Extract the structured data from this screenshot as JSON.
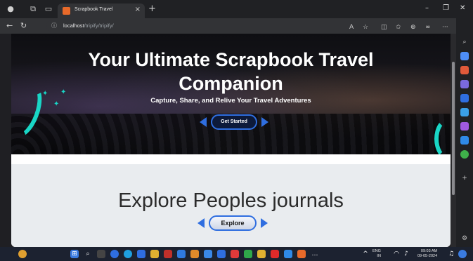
{
  "browser": {
    "tab_title": "Scrapbook Travel",
    "tab_close": "×",
    "new_tab": "+",
    "url_host": "localhost",
    "url_path": "/tripify/tripify/",
    "window_controls": {
      "minimize": "–",
      "maximize": "❐",
      "close": "✕"
    }
  },
  "hero": {
    "title_line1": "Your Ultimate Scrapbook Travel",
    "title_line2": "Companion",
    "subtitle": "Capture, Share, and Relive Your Travel Adventures",
    "cta_label": "Get Started",
    "accent_color": "#19d6c6",
    "button_border_color": "#2f6ee0"
  },
  "explore": {
    "title": "Explore Peoples journals",
    "button_label": "Explore"
  },
  "taskbar": {
    "lang": "ENG",
    "lang_region": "IN",
    "time": "09:03 AM",
    "date": "09-05-2024"
  }
}
